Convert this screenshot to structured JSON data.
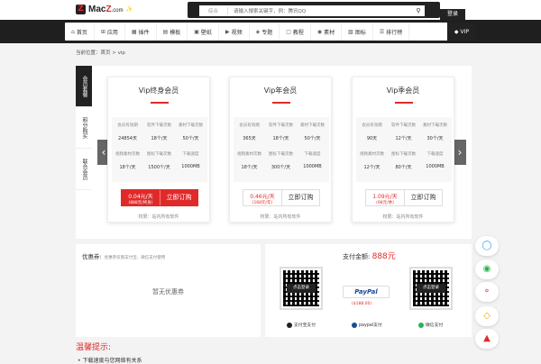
{
  "header": {
    "logo_mark": "Z",
    "logo_text_pre": "Mac",
    "logo_text_z": "Z",
    "logo_text_suffix": ".com",
    "logo_badge": "✨",
    "search_category": "综合",
    "search_placeholder": "请输入搜索关键字，例：腾讯QQ",
    "search_icon": "search-icon",
    "login_label": "登录"
  },
  "nav": {
    "items": [
      {
        "icon": "⌂",
        "label": "首页"
      },
      {
        "icon": "⊞",
        "label": "应用"
      },
      {
        "icon": "▦",
        "label": "插件"
      },
      {
        "icon": "▤",
        "label": "模板"
      },
      {
        "icon": "▣",
        "label": "壁纸"
      },
      {
        "icon": "▶",
        "label": "视频"
      },
      {
        "icon": "◈",
        "label": "专题"
      },
      {
        "icon": "▢",
        "label": "教程"
      },
      {
        "icon": "◉",
        "label": "素材"
      },
      {
        "icon": "▧",
        "label": "图标"
      },
      {
        "icon": "☰",
        "label": "排行榜"
      }
    ],
    "vip_icon": "◆",
    "vip_label": "VIP"
  },
  "breadcrumb": "当前位置：首页 > vip",
  "sidebar_tabs": [
    "会员套餐",
    "积分购买",
    "联合会员"
  ],
  "plans": [
    {
      "title": "Vip终身会员",
      "stats": [
        {
          "k": "会员有效期",
          "v": "24854天"
        },
        {
          "k": "软件下载次数",
          "v": "18个/天"
        },
        {
          "k": "素材下载次数",
          "v": "50个/天"
        },
        {
          "k": "视频素材次数",
          "v": "18个/天"
        },
        {
          "k": "图标下载次数",
          "v": "1500个/天"
        },
        {
          "k": "下载速度",
          "v": "1000MB"
        }
      ],
      "price": "0.04元/天",
      "price_sub": "(888元/终身)",
      "buy": "立即订购",
      "perm": "权限：站内所有软件"
    },
    {
      "title": "Vip年会员",
      "stats": [
        {
          "k": "会员有效期",
          "v": "365天"
        },
        {
          "k": "软件下载次数",
          "v": "18个/天"
        },
        {
          "k": "素材下载次数",
          "v": "50个/天"
        },
        {
          "k": "视频素材次数",
          "v": "18个/天"
        },
        {
          "k": "图标下载次数",
          "v": "300个/天"
        },
        {
          "k": "下载速度",
          "v": "1000MB"
        }
      ],
      "price": "0.46元/天",
      "price_sub": "(168元/年)",
      "buy": "立即订购",
      "perm": "权限：站内所有软件"
    },
    {
      "title": "Vip季会员",
      "stats": [
        {
          "k": "会员有效期",
          "v": "90天"
        },
        {
          "k": "软件下载次数",
          "v": "12个/天"
        },
        {
          "k": "素材下载次数",
          "v": "30个/天"
        },
        {
          "k": "视频素材次数",
          "v": "12个/天"
        },
        {
          "k": "图标下载次数",
          "v": "80个/天"
        },
        {
          "k": "下载速度",
          "v": "1000MB"
        }
      ],
      "price": "1.09元/天",
      "price_sub": "(98元/季)",
      "buy": "立即订购",
      "perm": "权限：站内所有软件"
    }
  ],
  "coupon": {
    "title": "优惠券:",
    "hint": "优惠券仅限支付宝、微信支付使用",
    "empty": "暂无优惠券"
  },
  "pay": {
    "amount_label": "支付金额:",
    "amount": "888元",
    "qr_login": "点击登录",
    "paypal_logo": "PayPal",
    "paypal_usd": "($188.00)",
    "alipay_label": "支付宝支付",
    "paypal_label": "paypal支付",
    "wechat_label": "微信支付"
  },
  "notice": {
    "title": "温馨提示:",
    "item": "• 下载速度与您网络有关系"
  },
  "float_icons": [
    "qq-icon",
    "wechat-icon",
    "sina-icon",
    "diamond-icon",
    "top-icon"
  ],
  "colors": {
    "accent": "#e02a2a",
    "dark": "#222222",
    "bg": "#f3f3f3"
  }
}
